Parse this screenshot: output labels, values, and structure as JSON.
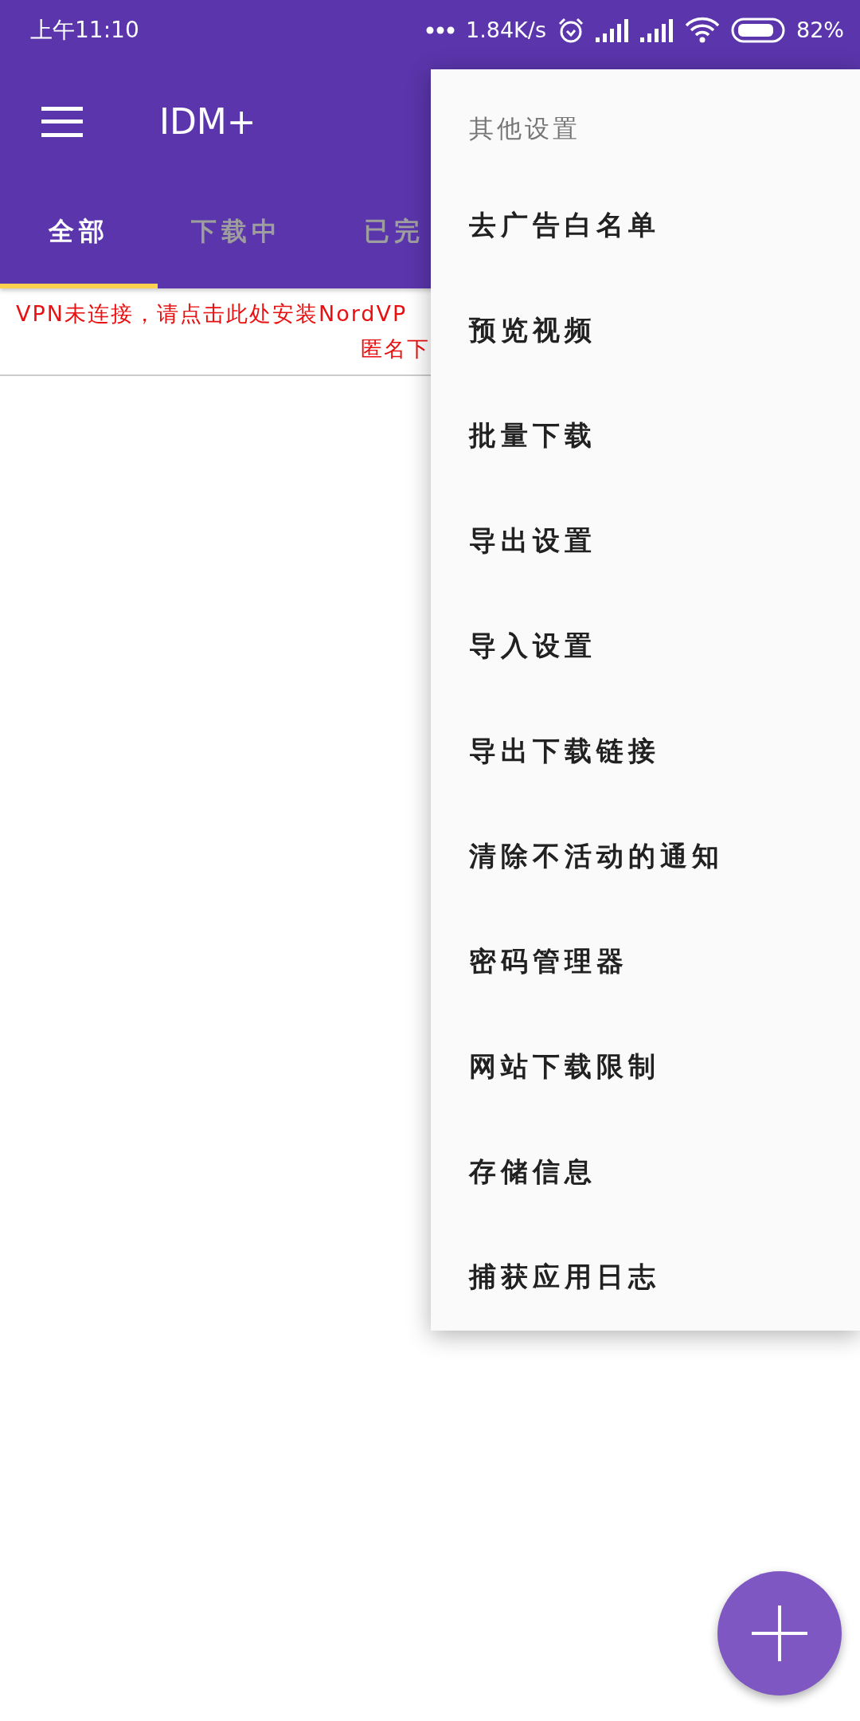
{
  "status_bar": {
    "time": "上午11:10",
    "speed": "1.84K/s",
    "battery": "82%"
  },
  "app_bar": {
    "title": "IDM+"
  },
  "tabs": [
    {
      "label": "全部",
      "selected": true
    },
    {
      "label": "下载中",
      "selected": false
    },
    {
      "label": "已完",
      "selected": false
    }
  ],
  "banner": {
    "lines": [
      "VPN未连接，请点击此处安装NordVP",
      "匿名下"
    ]
  },
  "menu": {
    "header": "其他设置",
    "items": [
      "去广告白名单",
      "预览视频",
      "批量下载",
      "导出设置",
      "导入设置",
      "导出下载链接",
      "清除不活动的通知",
      "密码管理器",
      "网站下载限制",
      "存储信息",
      "捕获应用日志"
    ]
  }
}
